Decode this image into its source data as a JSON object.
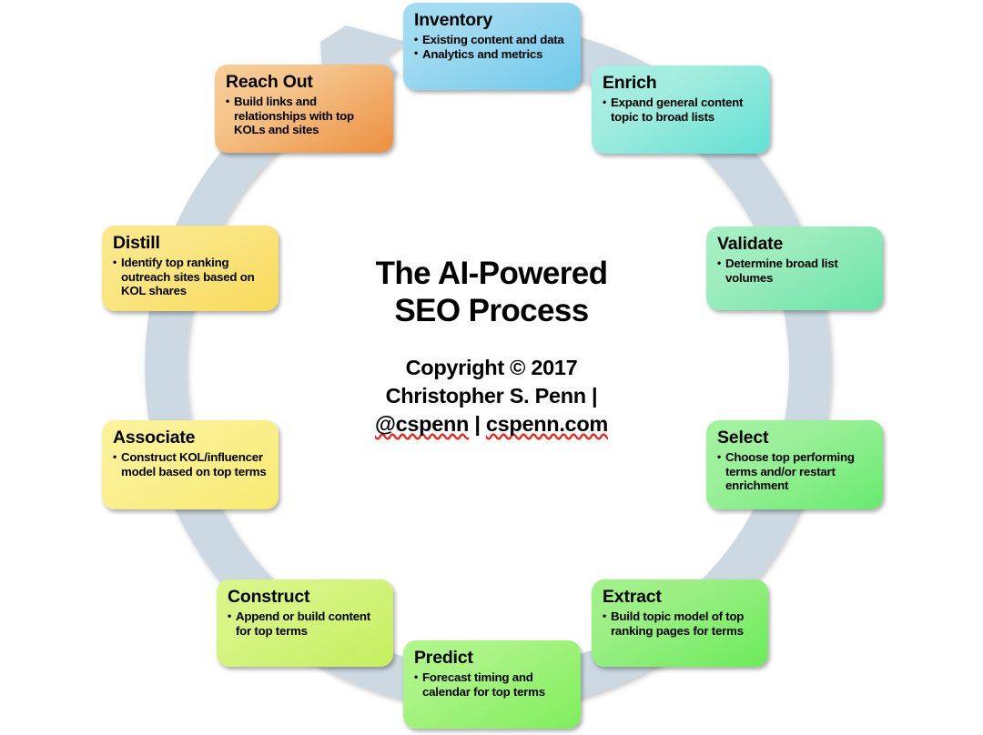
{
  "diagram": {
    "center": {
      "title_line1": "The AI-Powered",
      "title_line2": "SEO Process",
      "credit_line1": "Copyright © 2017",
      "credit_line2": "Christopher S. Penn |",
      "credit_line3_handle": "@cspenn",
      "credit_line3_sep": " | ",
      "credit_line3_site": "cspenn.com"
    },
    "ring": {
      "color": "#ccd9e2",
      "arrow_direction": "clockwise",
      "arrow_label": "clockwise-flow-arrow"
    },
    "steps": [
      {
        "id": "inventory",
        "title": "Inventory",
        "color": "#8ed6ef",
        "bullets": [
          "Existing content and data",
          "Analytics and metrics"
        ]
      },
      {
        "id": "enrich",
        "title": "Enrich",
        "color": "#8aeadd",
        "bullets": [
          "Expand general content topic to broad lists"
        ]
      },
      {
        "id": "validate",
        "title": "Validate",
        "color": "#8aedb7",
        "bullets": [
          "Determine broad list volumes"
        ]
      },
      {
        "id": "select",
        "title": "Select",
        "color": "#8cef89",
        "bullets": [
          "Choose top performing terms and/or restart enrichment"
        ]
      },
      {
        "id": "extract",
        "title": "Extract",
        "color": "#8bee77",
        "bullets": [
          "Build topic model of top ranking pages for terms"
        ]
      },
      {
        "id": "predict",
        "title": "Predict",
        "color": "#9cf27a",
        "bullets": [
          "Forecast timing and calendar for top terms"
        ]
      },
      {
        "id": "construct",
        "title": "Construct",
        "color": "#d2f275",
        "bullets": [
          "Append or build content for top terms"
        ]
      },
      {
        "id": "associate",
        "title": "Associate",
        "color": "#faf08a",
        "bullets": [
          "Construct KOL/influencer model based on top terms"
        ]
      },
      {
        "id": "distill",
        "title": "Distill",
        "color": "#f9e57d",
        "bullets": [
          "Identify top ranking outreach sites based on KOL shares"
        ]
      },
      {
        "id": "reachout",
        "title": "Reach Out",
        "color": "#f0a55c",
        "bullets": [
          "Build links and relationships with top KOLs and sites"
        ]
      }
    ]
  }
}
